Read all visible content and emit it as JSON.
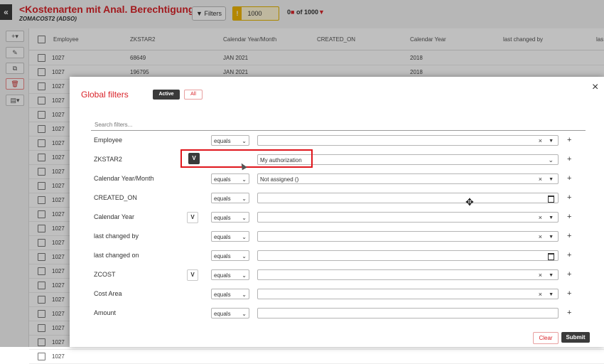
{
  "app": {
    "back_label": "«",
    "title": "<Kostenarten mit Anal. Berechtigung>",
    "subtitle": "ZOMACOST2 (ADSO)",
    "filters_label": "Filters",
    "rows_value": "1000",
    "count_prefix": "0",
    "count_suffix": "of 1000",
    "tools": [
      "+▾",
      "✎",
      "⧉",
      "🗑",
      "▤▾"
    ]
  },
  "grid": {
    "columns": [
      "Employee",
      "ZKSTAR2",
      "Calendar Year/Month",
      "CREATED_ON",
      "Calendar Year",
      "last changed by",
      "las"
    ],
    "rows": [
      {
        "employee": "1027",
        "zkstar2": "68649",
        "month": "JAN 2021",
        "year": "2018"
      },
      {
        "employee": "1027",
        "zkstar2": "196795",
        "month": "JAN 2021",
        "year": "2018"
      },
      {
        "employee": "1027"
      },
      {
        "employee": "1027"
      },
      {
        "employee": "1027"
      },
      {
        "employee": "1027"
      },
      {
        "employee": "1027"
      },
      {
        "employee": "1027"
      },
      {
        "employee": "1027"
      },
      {
        "employee": "1027"
      },
      {
        "employee": "1027"
      },
      {
        "employee": "1027"
      },
      {
        "employee": "1027"
      },
      {
        "employee": "1027"
      },
      {
        "employee": "1027"
      },
      {
        "employee": "1027"
      },
      {
        "employee": "1027"
      },
      {
        "employee": "1027"
      },
      {
        "employee": "1027"
      },
      {
        "employee": "1027"
      },
      {
        "employee": "1027"
      },
      {
        "employee": "1027"
      }
    ]
  },
  "dialog": {
    "title": "Global filters",
    "tab_active": "Active",
    "tab_all": "All",
    "close": "×",
    "search_placeholder": "Search filters...",
    "filters": [
      {
        "label": "Employee",
        "operator": "equals",
        "value": "",
        "variable": false,
        "kind": "select"
      },
      {
        "label": "ZKSTAR2",
        "operator": "",
        "value": "My authorization",
        "variable": true,
        "kind": "select"
      },
      {
        "label": "Calendar Year/Month",
        "operator": "equals",
        "value": "Not assigned ()",
        "variable": false,
        "kind": "select"
      },
      {
        "label": "CREATED_ON",
        "operator": "equals",
        "value": "",
        "variable": false,
        "kind": "date"
      },
      {
        "label": "Calendar Year",
        "operator": "equals",
        "value": "",
        "variable": true,
        "kind": "select"
      },
      {
        "label": "last changed by",
        "operator": "equals",
        "value": "",
        "variable": false,
        "kind": "select"
      },
      {
        "label": "last changed on",
        "operator": "equals",
        "value": "",
        "variable": false,
        "kind": "date"
      },
      {
        "label": "ZCOST",
        "operator": "equals",
        "value": "",
        "variable": true,
        "kind": "select"
      },
      {
        "label": "Cost Area",
        "operator": "equals",
        "value": "",
        "variable": false,
        "kind": "select"
      },
      {
        "label": "Amount",
        "operator": "equals",
        "value": "",
        "variable": false,
        "kind": "text"
      }
    ],
    "variable_label": "V",
    "clear_label": "Clear",
    "submit_label": "Submit"
  }
}
